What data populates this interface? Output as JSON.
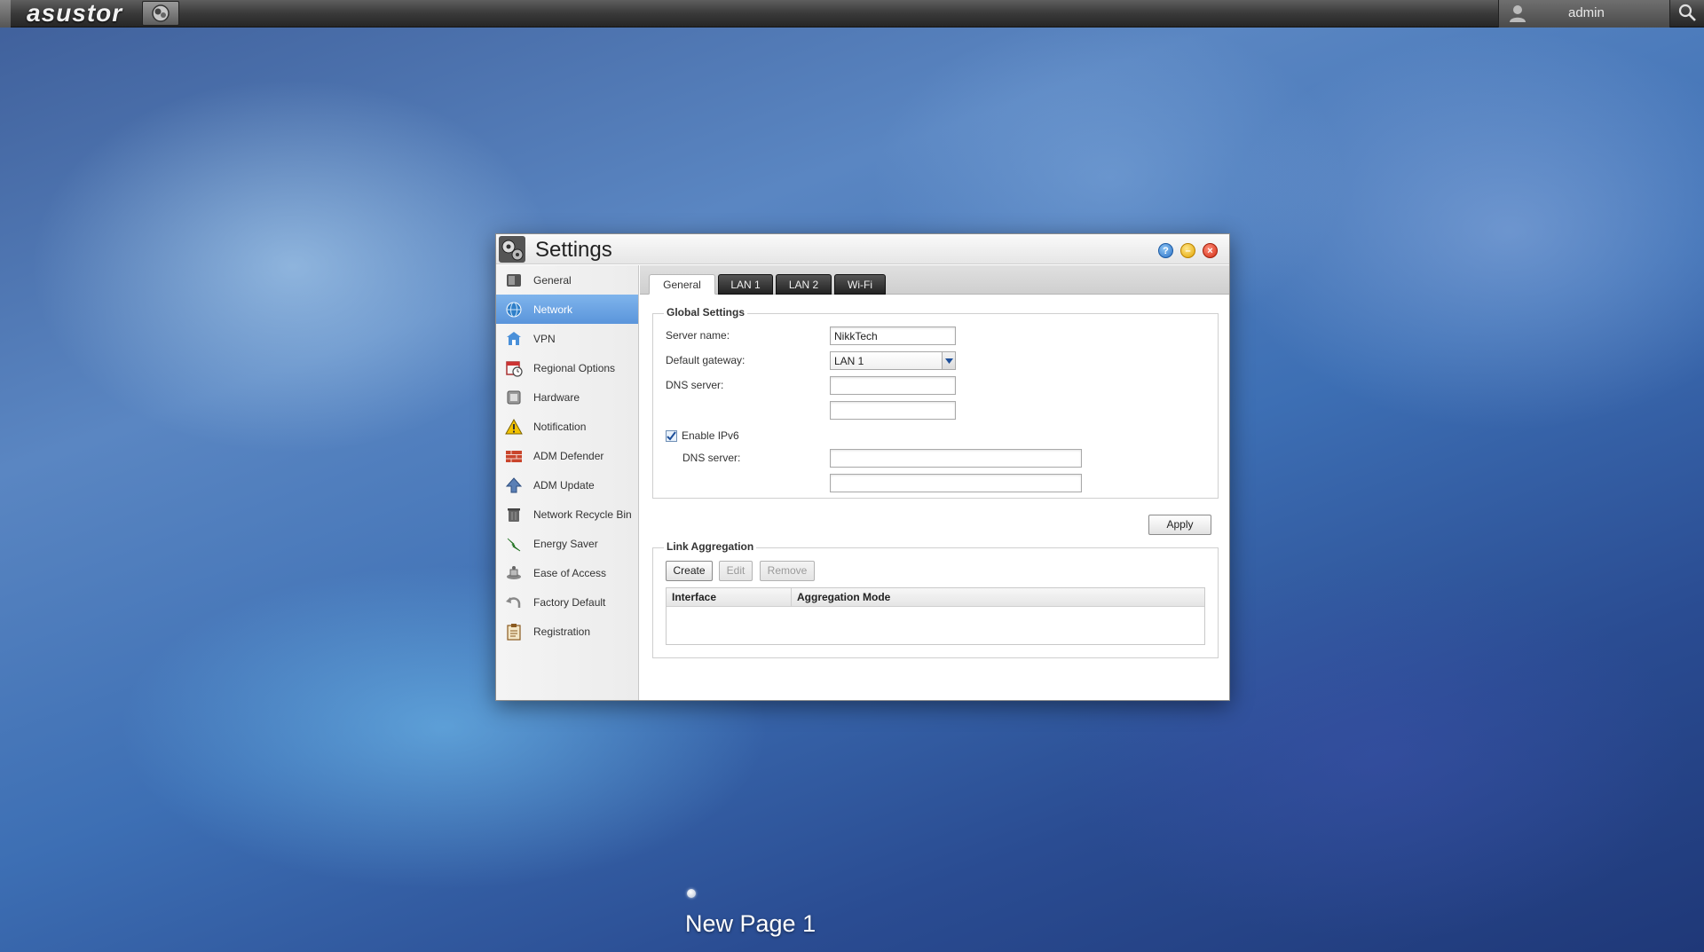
{
  "topbar": {
    "logo": "asustor",
    "username": "admin"
  },
  "window": {
    "title": "Settings",
    "controls": {
      "help_icon": "question-icon",
      "minimize_icon": "minimize-icon",
      "close_icon": "close-icon"
    }
  },
  "sidebar": {
    "items": [
      {
        "label": "General",
        "icon": "general-icon",
        "active": false
      },
      {
        "label": "Network",
        "icon": "globe-icon",
        "active": true
      },
      {
        "label": "VPN",
        "icon": "vpn-icon",
        "active": false
      },
      {
        "label": "Regional Options",
        "icon": "calendar-clock-icon",
        "active": false
      },
      {
        "label": "Hardware",
        "icon": "hardware-icon",
        "active": false
      },
      {
        "label": "Notification",
        "icon": "warning-icon",
        "active": false
      },
      {
        "label": "ADM Defender",
        "icon": "firewall-icon",
        "active": false
      },
      {
        "label": "ADM Update",
        "icon": "update-arrow-icon",
        "active": false
      },
      {
        "label": "Network Recycle Bin",
        "icon": "trash-icon",
        "active": false
      },
      {
        "label": "Energy Saver",
        "icon": "energy-icon",
        "active": false
      },
      {
        "label": "Ease of Access",
        "icon": "access-icon",
        "active": false
      },
      {
        "label": "Factory Default",
        "icon": "undo-icon",
        "active": false
      },
      {
        "label": "Registration",
        "icon": "clipboard-icon",
        "active": false
      }
    ]
  },
  "tabs": [
    {
      "label": "General",
      "active": true
    },
    {
      "label": "LAN 1",
      "active": false
    },
    {
      "label": "LAN 2",
      "active": false
    },
    {
      "label": "Wi-Fi",
      "active": false
    }
  ],
  "global_settings": {
    "legend": "Global Settings",
    "server_name_label": "Server name:",
    "server_name_value": "NikkTech",
    "default_gateway_label": "Default gateway:",
    "default_gateway_value": "LAN 1",
    "dns_server_label": "DNS server:",
    "dns1_value": "",
    "dns2_value": "",
    "enable_ipv6_label": "Enable IPv6",
    "enable_ipv6_checked": true,
    "ipv6_dns_label": "DNS server:",
    "ipv6_dns1_value": "",
    "ipv6_dns2_value": ""
  },
  "apply_label": "Apply",
  "link_aggregation": {
    "legend": "Link Aggregation",
    "create_label": "Create",
    "edit_label": "Edit",
    "remove_label": "Remove",
    "columns": [
      "Interface",
      "Aggregation Mode"
    ]
  },
  "desktop": {
    "page_label": "New Page 1"
  }
}
